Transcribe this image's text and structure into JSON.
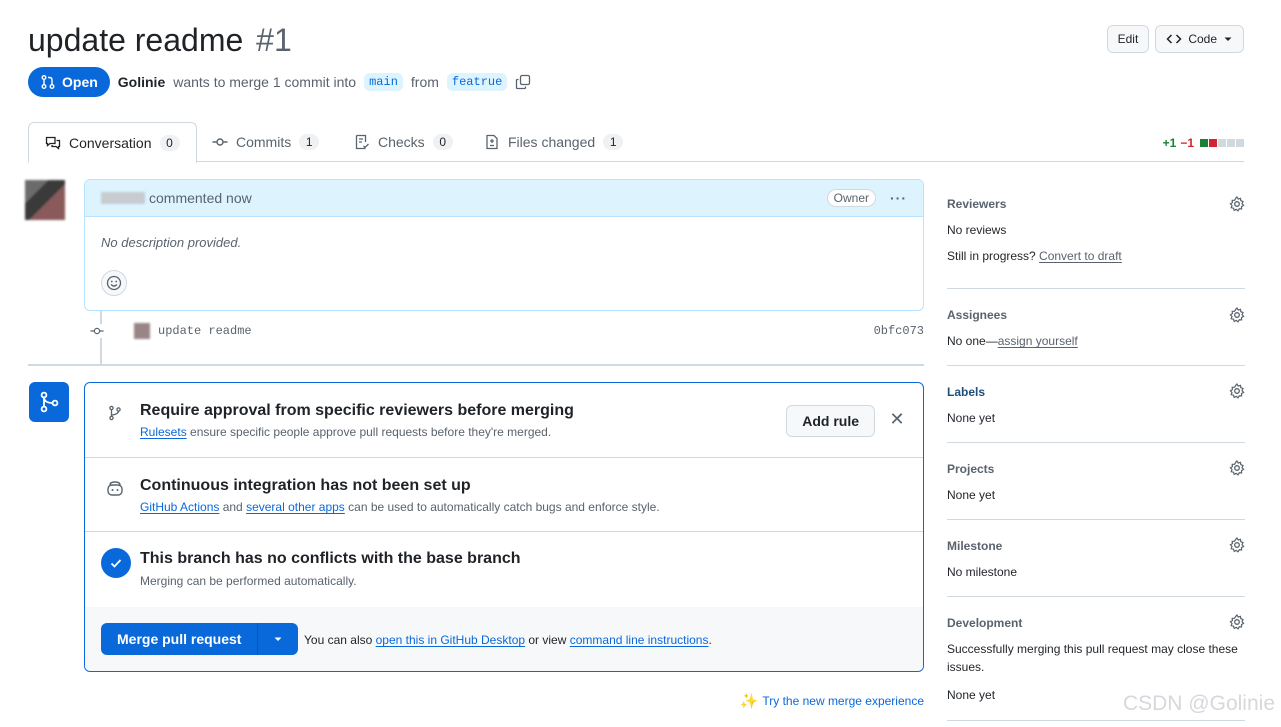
{
  "header": {
    "title": "update readme",
    "number": "#1",
    "edit_label": "Edit",
    "code_label": "Code"
  },
  "state": {
    "badge": "Open",
    "author": "Golinie",
    "text_mid": "wants to merge 1 commit into",
    "base_branch": "main",
    "text_from": "from",
    "head_branch": "featrue"
  },
  "tabs": [
    {
      "label": "Conversation",
      "count": "0"
    },
    {
      "label": "Commits",
      "count": "1"
    },
    {
      "label": "Checks",
      "count": "0"
    },
    {
      "label": "Files changed",
      "count": "1"
    }
  ],
  "diffstat": {
    "additions": "+1",
    "deletions": "−1"
  },
  "comment": {
    "time": "commented now",
    "role_badge": "Owner",
    "body": "No description provided."
  },
  "commit": {
    "message": "update readme",
    "sha": "0bfc073"
  },
  "merge_box": {
    "rule_title": "Require approval from specific reviewers before merging",
    "rule_link": "Rulesets",
    "rule_sub": " ensure specific people approve pull requests before they're merged.",
    "add_rule": "Add rule",
    "ci_title": "Continuous integration has not been set up",
    "ci_link1": "GitHub Actions",
    "ci_and": " and ",
    "ci_link2": "several other apps",
    "ci_sub": " can be used to automatically catch bugs and enforce style.",
    "ok_title": "This branch has no conflicts with the base branch",
    "ok_sub": "Merging can be performed automatically.",
    "merge_button": "Merge pull request",
    "also_text": "You can also ",
    "desktop_link": "open this in GitHub Desktop",
    "or_view": " or view ",
    "cli_link": "command line instructions",
    "period": "."
  },
  "try_new": "Try the new merge experience",
  "sidebar": {
    "reviewers": {
      "title": "Reviewers",
      "value": "No reviews",
      "progress_text": "Still in progress? ",
      "progress_link": "Convert to draft"
    },
    "assignees": {
      "title": "Assignees",
      "value": "No one—",
      "link": "assign yourself"
    },
    "labels": {
      "title": "Labels",
      "value": "None yet"
    },
    "projects": {
      "title": "Projects",
      "value": "None yet"
    },
    "milestone": {
      "title": "Milestone",
      "value": "No milestone"
    },
    "development": {
      "title": "Development",
      "value_line1": "Successfully merging this pull request may close these",
      "value_line2": "issues.",
      "value2": "None yet"
    }
  },
  "watermark": "CSDN @Golinie",
  "colors": {
    "accent": "#0969da",
    "addition": "#1a7f37",
    "deletion": "#d1242f"
  }
}
